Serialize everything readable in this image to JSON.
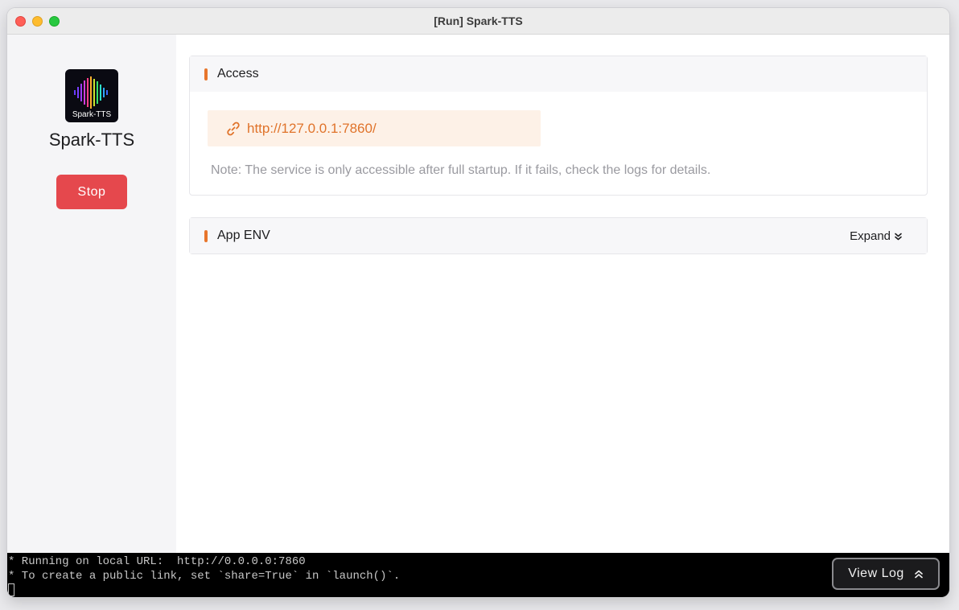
{
  "window": {
    "title": "[Run] Spark-TTS"
  },
  "sidebar": {
    "app_icon_label": "Spark-TTS",
    "app_name": "Spark-TTS",
    "stop_label": "Stop"
  },
  "access": {
    "title": "Access",
    "url": "http://127.0.0.1:7860/",
    "note": "Note: The service is only accessible after full startup. If it fails, check the logs for details."
  },
  "env": {
    "title": "App ENV",
    "expand_label": "Expand"
  },
  "terminal": {
    "lines": [
      "* Running on local URL:  http://0.0.0.0:7860",
      "* To create a public link, set `share=True` in `launch()`."
    ],
    "view_log_label": "View Log"
  },
  "colors": {
    "accent": "#e8762c",
    "stop": "#e5484d",
    "url_bg": "#fdf1e7"
  }
}
